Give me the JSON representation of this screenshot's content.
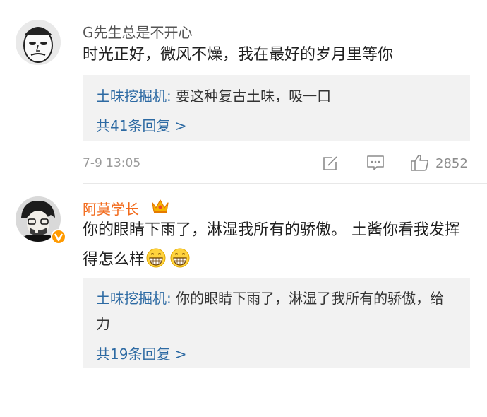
{
  "comments": [
    {
      "username": "G先生总是不开心",
      "text": "时光正好，微风不燥，我在最好的岁月里等你",
      "reply": {
        "user": "土味挖掘机:",
        "text": " 要这种复古土味，吸一口",
        "count_label": "共41条回复 >"
      },
      "time": "7-9 13:05",
      "likes": "2852"
    },
    {
      "username": "阿莫学长",
      "text": "你的眼睛下雨了，淋湿我所有的骄傲。   土酱你看我发挥得怎么样",
      "reply": {
        "user": "土味挖掘机:",
        "text": " 你的眼睛下雨了，淋湿了我所有的骄傲，给力",
        "count_label": "共19条回复 >"
      }
    }
  ],
  "colors": {
    "vip_name": "#f26a1b",
    "link_blue": "#2d6aa3",
    "reply_bg": "#f2f2f2",
    "meta_gray": "#9a9a9a"
  },
  "icons": [
    "edit-icon",
    "comment-icon",
    "thumbs-up-icon",
    "crown-icon",
    "grin-emoji-icon",
    "verified-badge-icon"
  ]
}
